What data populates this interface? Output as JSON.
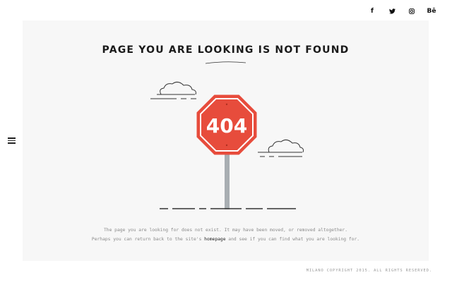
{
  "social": {
    "facebook": {
      "icon": "facebook-icon",
      "glyph": "f"
    },
    "twitter": {
      "icon": "twitter-icon",
      "glyph": "🐦"
    },
    "instagram": {
      "icon": "instagram-icon",
      "glyph": "◙"
    },
    "behance": {
      "icon": "behance-icon",
      "glyph": "Bē"
    }
  },
  "menu": {
    "icon": "hamburger-menu-icon"
  },
  "main": {
    "title": "PAGE YOU ARE LOOKING IS NOT FOUND",
    "sign_text": "404",
    "message_line1": "The page you are looking for does not exist. It may have been moved, or removed altogether.",
    "message_line2_before": "Perhaps you can return back to the site's ",
    "message_link": "homepage",
    "message_line2_after": " and see if you can find what you are looking for."
  },
  "footer": {
    "copyright": "MILANO COPYRIGHT 2015. ALL RIGHTS RESERVED."
  },
  "colors": {
    "sign_red": "#e74c3c",
    "pole": "#a8aeb2",
    "panel_bg": "#f7f7f7"
  }
}
